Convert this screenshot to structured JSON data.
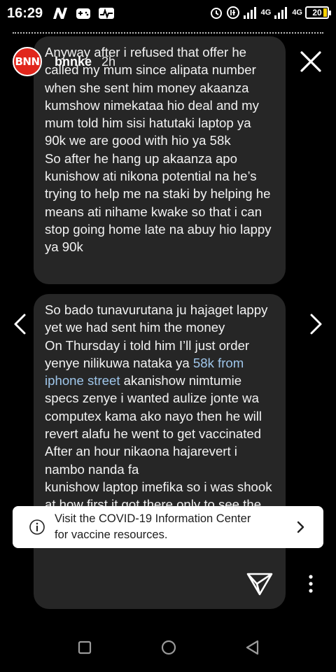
{
  "status_bar": {
    "time": "16:29",
    "lte_label_1": "4G",
    "lte_label_2": "4G",
    "battery": "20",
    "icons": [
      "n-app-icon",
      "game-controller-icon",
      "activity-icon",
      "alarm-clock-icon",
      "data-saver-icon",
      "signal-icon",
      "signal-icon",
      "battery-icon"
    ]
  },
  "story": {
    "username": "bnnke",
    "time_ago": "2h",
    "avatar_text": "BNN",
    "colors": {
      "avatar_bg": "#e1261c",
      "bubble_bg": "#262626",
      "link": "#9fc6ea"
    }
  },
  "chat": {
    "bubble1_text": "Anyway after i refused that offer he called my mum since alipata number when she sent him money akaanza kumshow nimekataa hio deal and my mum told him sisi hatutaki laptop ya 90k we are good with hio ya 58k\nSo after he hang up akaanza apo kunishow ati nikona potential na he’s trying to help me na staki by helping he means ati nihame kwake so that i can stop going home late na abuy hio lappy ya 90k",
    "bubble2_a": "So bado tunavurutana ju hajaget lappy yet we had sent him the money\nOn Thursday i told him I’ll just order yenye nilikuwa nataka ya ",
    "bubble2_link": "58k from iphone street",
    "bubble2_b": " akanishow nimtumie specs zenye i wanted aulize jonte wa computex kama ako nayo then he will revert alafu he went to get vaccinated\nAfter an hour nikaona hajarevert i",
    "bubble2_hidden": "nambo nanda fa",
    "bubble2_c": "kunishow laptop imefika so i was shook at how first it got there only to see the bag imeandikwa computex"
  },
  "banner": {
    "line1": "Visit the COVID-19 Information Center",
    "line2": "for vaccine resources."
  },
  "icons": {
    "close": "close-icon",
    "prev": "chevron-left-icon",
    "next": "chevron-right-icon",
    "info": "info-icon",
    "send": "send-icon",
    "more": "more-vertical-icon"
  }
}
